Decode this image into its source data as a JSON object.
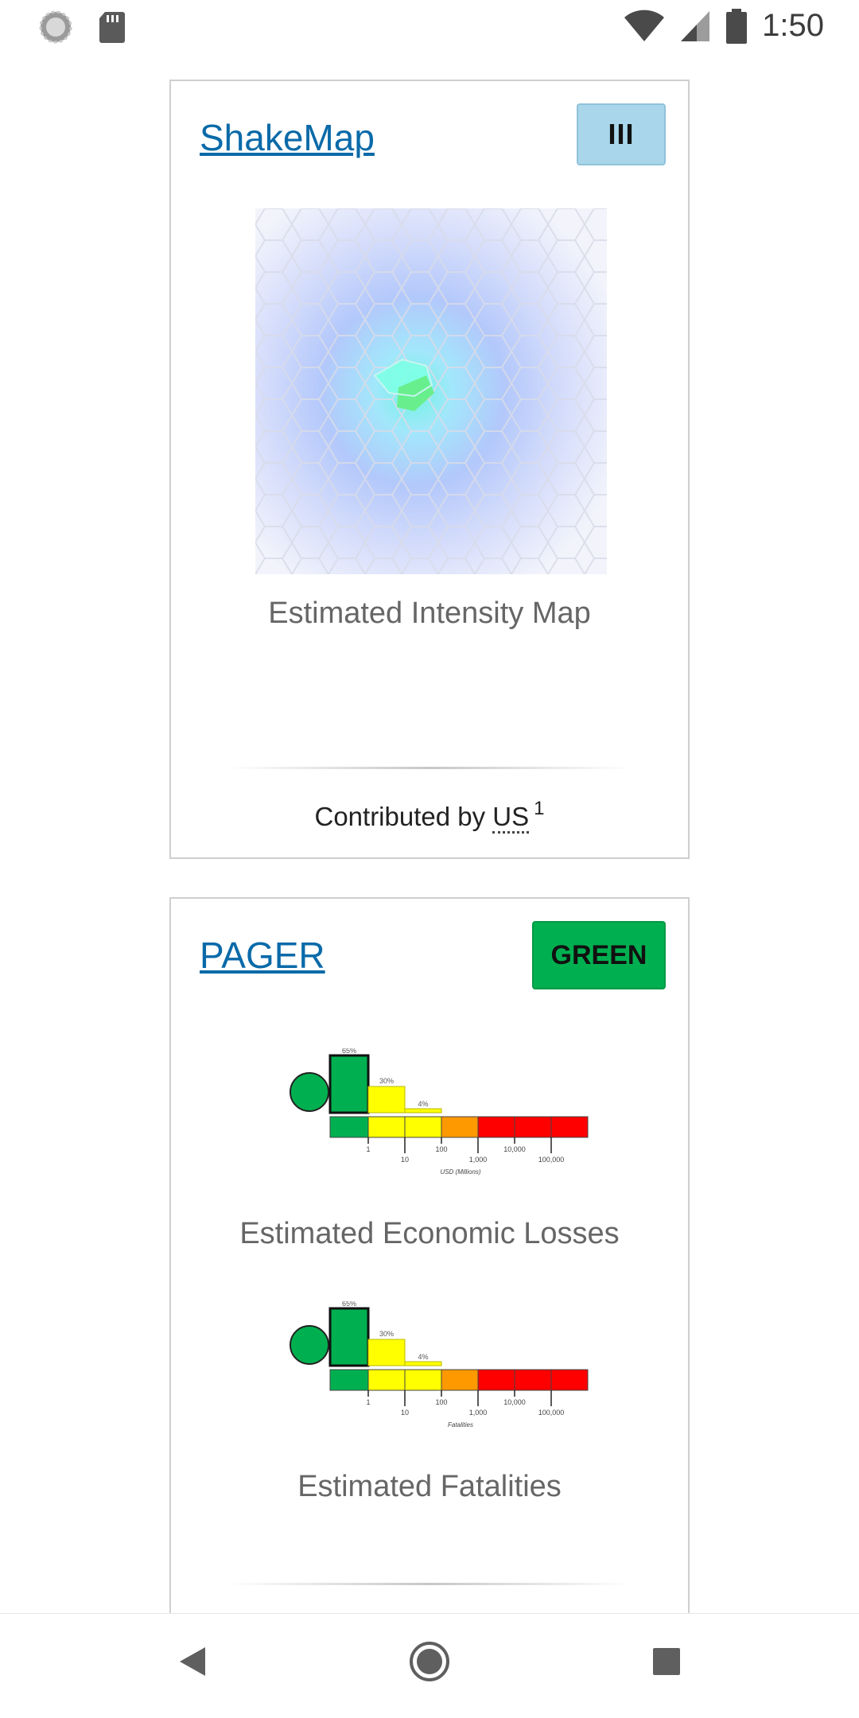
{
  "status_bar": {
    "time": "1:50",
    "left_icons": [
      "sync-icon",
      "sd-card-icon"
    ],
    "right_icons": [
      "wifi-icon",
      "cell-signal-icon",
      "battery-icon"
    ]
  },
  "shakemap_card": {
    "title": "ShakeMap",
    "badge": "III",
    "badge_color": "#a9d6ea",
    "caption": "Estimated Intensity Map",
    "contributed_prefix": "Contributed by",
    "contributor": "US",
    "footnote": "1"
  },
  "pager_card": {
    "title": "PAGER",
    "alert": "GREEN",
    "alert_color": "#00b050",
    "econ_chart": {
      "percents": [
        "65%",
        "30%",
        "4%"
      ],
      "ticks_upper": [
        "1",
        "100",
        "10,000",
        "100,000"
      ],
      "ticks_lower": [
        "10",
        "1,000"
      ],
      "axis_label": "USD (Millions)",
      "caption": "Estimated Economic Losses"
    },
    "fatal_chart": {
      "percents": [
        "65%",
        "30%",
        "4%"
      ],
      "ticks_upper": [
        "1",
        "100",
        "10,000",
        "100,000"
      ],
      "ticks_lower": [
        "10",
        "1,000"
      ],
      "axis_label": "Fatalities",
      "caption": "Estimated Fatalities"
    }
  },
  "nav_bar": {
    "buttons": [
      "back-icon",
      "home-icon",
      "recents-icon"
    ]
  }
}
